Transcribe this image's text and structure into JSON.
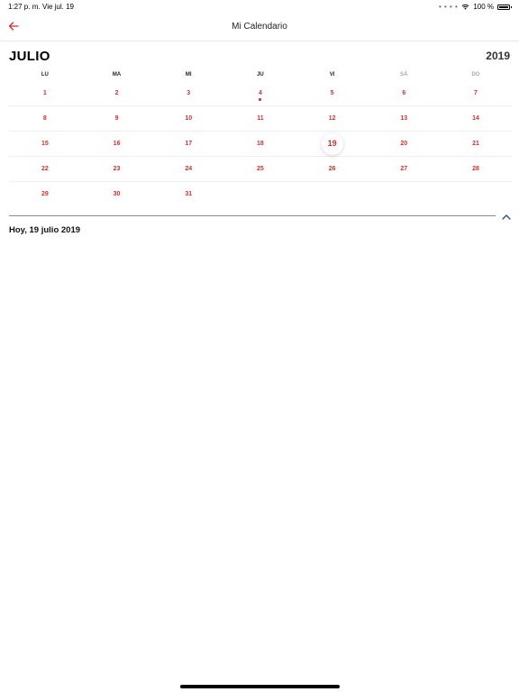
{
  "status_bar": {
    "time": "1:27 p. m.",
    "date": "Vie jul. 19",
    "battery_text": "100 %",
    "dots": "• • • •"
  },
  "nav": {
    "title": "Mi Calendario",
    "back_icon": "arrow-left-icon"
  },
  "calendar": {
    "month": "JULIO",
    "year": "2019",
    "weekdays": [
      "LU",
      "MA",
      "MI",
      "JU",
      "VI",
      "SÁ",
      "DO"
    ],
    "weeks": [
      [
        "1",
        "2",
        "3",
        "4",
        "5",
        "6",
        "7"
      ],
      [
        "8",
        "9",
        "10",
        "11",
        "12",
        "13",
        "14"
      ],
      [
        "15",
        "16",
        "17",
        "18",
        "19",
        "20",
        "21"
      ],
      [
        "22",
        "23",
        "24",
        "25",
        "26",
        "27",
        "28"
      ],
      [
        "29",
        "30",
        "31",
        "",
        "",
        "",
        ""
      ]
    ],
    "today": "19",
    "event_days": [
      "4"
    ]
  },
  "today_label": "Hoy, 19 julio 2019",
  "colors": {
    "accent": "#d32f2f",
    "collapse_icon": "#2a4f8f"
  }
}
